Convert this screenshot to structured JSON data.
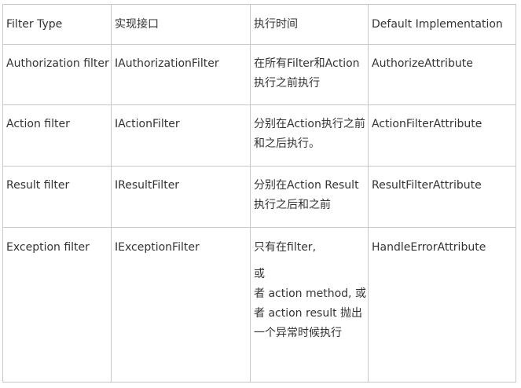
{
  "table": {
    "headers": [
      "Filter Type",
      "实现接口",
      "执行时间",
      "Default Implementation"
    ],
    "rows": [
      {
        "filter_type": "Authorization filter",
        "interface": "IAuthorizationFilter",
        "timing_lines": [
          "在所有Filter和Action",
          "执行之前执行"
        ],
        "default_impl": "AuthorizeAttribute"
      },
      {
        "filter_type": "Action filter",
        "interface": "IActionFilter",
        "timing_lines": [
          "分别在Action执行之前",
          "和之后执行。"
        ],
        "default_impl": "ActionFilterAttribute"
      },
      {
        "filter_type": "Result filter",
        "interface": "IResultFilter",
        "timing_lines": [
          "分别在Action Result",
          "执行之后和之前"
        ],
        "default_impl": "ResultFilterAttribute"
      },
      {
        "filter_type": "Exception filter",
        "interface": "IExceptionFilter",
        "timing_lines": [
          "只有在filter,",
          "或",
          "者 action method, 或",
          "者 action result 抛出",
          "一个异常时候执行"
        ],
        "default_impl": "HandleErrorAttribute"
      }
    ]
  }
}
